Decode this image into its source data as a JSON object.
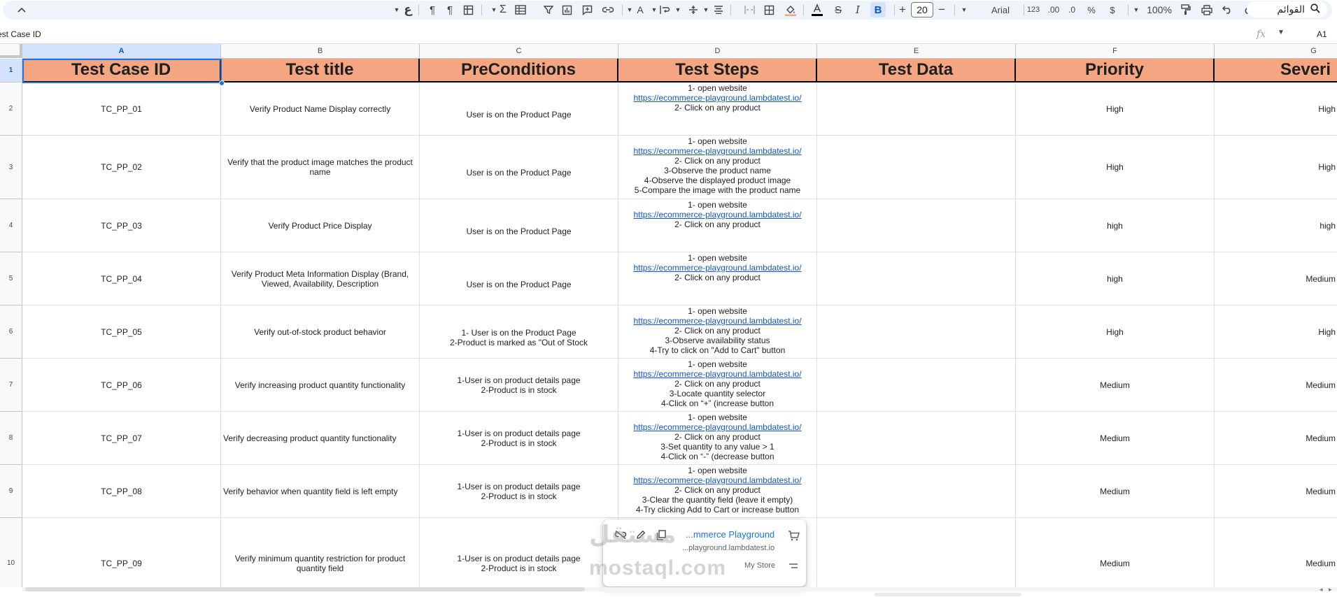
{
  "toolbar": {
    "font_name": "Arial",
    "font_size": "20",
    "zoom": "100%",
    "currency_symbol": "$",
    "percent_symbol": "%",
    "dec_decrease": ".0",
    "dec_increase": ".00",
    "number_format": "123",
    "bold_label": "B",
    "italic_label": "I",
    "menus_label": "القوائم",
    "arabic_glyph": "ع"
  },
  "formula_bar": {
    "content": "est Case ID",
    "cell_ref": "A1",
    "fx": "fx"
  },
  "columns": [
    "A",
    "B",
    "C",
    "D",
    "E",
    "F",
    "G"
  ],
  "headers": [
    "Test Case ID",
    "Test title",
    "PreConditions",
    "Test Steps",
    "Test Data",
    "Priority",
    "Severi"
  ],
  "rows": [
    {
      "num": "2",
      "id": "TC_PP_01",
      "title": "Verify Product Name Display correctly",
      "pre": [
        "User is on the Product Page"
      ],
      "steps": [
        "1- open website",
        "https://ecommerce-playground.lambdatest.io/",
        "2- Click on any product"
      ],
      "data": "",
      "priority": "High",
      "severity": "High"
    },
    {
      "num": "3",
      "id": "TC_PP_02",
      "title": "Verify that the product image matches the product name",
      "pre": [
        "User is on the Product Page"
      ],
      "steps": [
        "1- open website",
        "https://ecommerce-playground.lambdatest.io/",
        "2- Click on any product",
        "3-Observe the product name",
        "4-Observe the displayed product image",
        "5-Compare the image with the product name"
      ],
      "data": "",
      "priority": "High",
      "severity": "High"
    },
    {
      "num": "4",
      "id": "TC_PP_03",
      "title": "Verify Product Price Display",
      "pre": [
        "User is on the Product Page"
      ],
      "steps": [
        "1- open website",
        "https://ecommerce-playground.lambdatest.io/",
        "2- Click on any product"
      ],
      "data": "",
      "priority": "high",
      "severity": "high"
    },
    {
      "num": "5",
      "id": "TC_PP_04",
      "title": "Verify Product Meta Information Display (Brand, Viewed, Availability, Description",
      "pre": [
        "User is on the Product Page"
      ],
      "steps": [
        "1- open website",
        "https://ecommerce-playground.lambdatest.io/",
        "2- Click on any product"
      ],
      "data": "",
      "priority": "high",
      "severity": "Medium"
    },
    {
      "num": "6",
      "id": "TC_PP_05",
      "title": "Verify out-of-stock product behavior",
      "pre": [
        "1- User is on the Product Page",
        "2-Product is marked as \"Out of Stock"
      ],
      "steps": [
        "1- open website",
        "https://ecommerce-playground.lambdatest.io/",
        "2- Click on any product",
        "3-Observe availability status",
        "4-Try to click on \"Add to Cart\" button"
      ],
      "data": "",
      "priority": "High",
      "severity": "High"
    },
    {
      "num": "7",
      "id": "TC_PP_06",
      "title": "Verify increasing product quantity functionality",
      "pre": [
        "1-User is on product details page",
        "2-Product is in stock"
      ],
      "steps": [
        "1- open website",
        "https://ecommerce-playground.lambdatest.io/",
        "2- Click on any product",
        "3-Locate quantity selector",
        "4-Click on “+” (increase button"
      ],
      "data": "",
      "priority": "Medium",
      "severity": "Medium"
    },
    {
      "num": "8",
      "id": "TC_PP_07",
      "title": "Verify decreasing product quantity functionality",
      "pre": [
        "1-User is on product details page",
        "2-Product is in stock"
      ],
      "steps": [
        "1- open website",
        "https://ecommerce-playground.lambdatest.io/",
        "2- Click on any product",
        "3-Set quantity to any value > 1",
        "4-Click on “-” (decrease button"
      ],
      "data": "",
      "priority": "Medium",
      "severity": "Medium"
    },
    {
      "num": "9",
      "id": "TC_PP_08",
      "title": "Verify behavior when quantity field is left empty",
      "pre": [
        "1-User is on product details page",
        "2-Product is in stock"
      ],
      "steps": [
        "1- open website",
        "https://ecommerce-playground.lambdatest.io/",
        "2- Click on any product",
        "3-Clear the quantity field (leave it empty)",
        "4-Try clicking Add to Cart or increase button"
      ],
      "data": "",
      "priority": "Medium",
      "severity": "Medium"
    },
    {
      "num": "10",
      "id": "TC_PP_09",
      "title": "Verify minimum quantity restriction for product quantity field",
      "pre": [
        "1-User is on product details page",
        "2-Product is in stock"
      ],
      "steps": [],
      "data": "",
      "priority": "Medium",
      "severity": "Medium"
    }
  ],
  "link_popup": {
    "title": "...mmerce Playground",
    "url": "...playground.lambdatest.io",
    "site": "My Store"
  },
  "watermark": {
    "arabic": "مستقل",
    "latin": "mostaql.com"
  },
  "colors": {
    "header_fill": "#f4a582",
    "link": "#1155cc",
    "selection": "#1a73e8"
  }
}
